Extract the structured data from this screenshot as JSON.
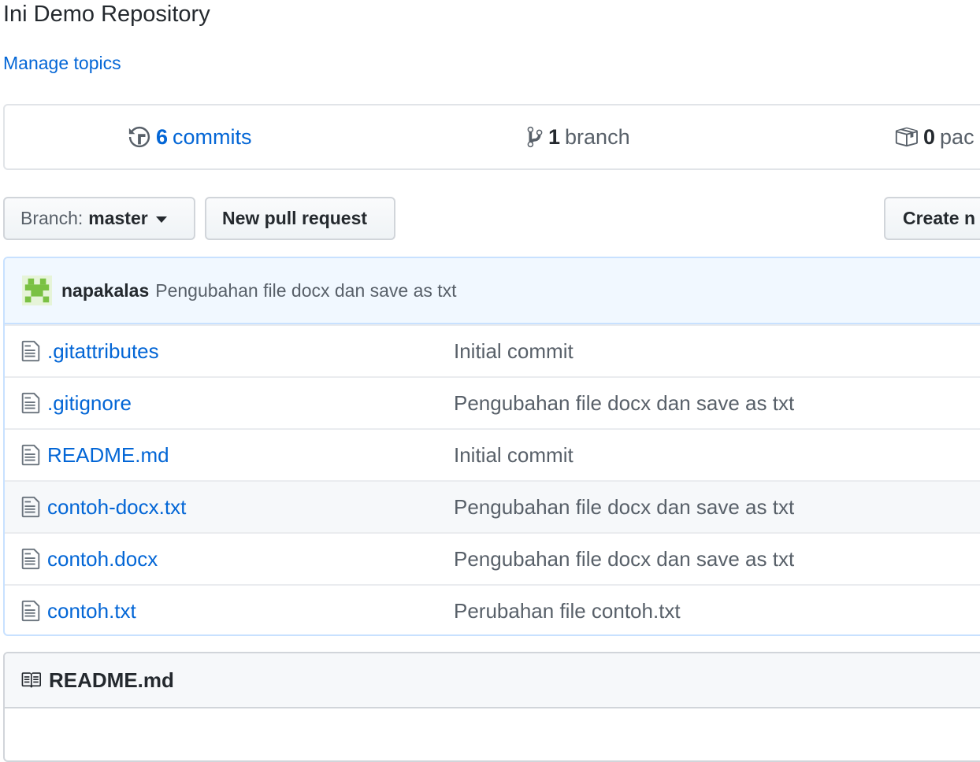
{
  "repo": {
    "description": "Ini Demo Repository",
    "manage_topics": "Manage topics"
  },
  "summary": {
    "commits": {
      "count": "6",
      "label": "commits",
      "icon": "history-icon"
    },
    "branches": {
      "count": "1",
      "label": "branch",
      "icon": "git-branch-icon"
    },
    "packages": {
      "count": "0",
      "label": "pac",
      "icon": "package-icon"
    }
  },
  "toolbar": {
    "branch_prefix": "Branch:",
    "branch_name": "master",
    "new_pull_request": "New pull request",
    "create_new_file": "Create n"
  },
  "commit_tease": {
    "author": "napakalas",
    "message": "Pengubahan file docx dan save as txt"
  },
  "files": [
    {
      "name": ".gitattributes",
      "message": "Initial commit",
      "icon": "file-icon"
    },
    {
      "name": ".gitignore",
      "message": "Pengubahan file docx dan save as txt",
      "icon": "file-icon"
    },
    {
      "name": "README.md",
      "message": "Initial commit",
      "icon": "file-icon"
    },
    {
      "name": "contoh-docx.txt",
      "message": "Pengubahan file docx dan save as txt",
      "icon": "file-icon",
      "highlighted": true
    },
    {
      "name": "contoh.docx",
      "message": "Pengubahan file docx dan save as txt",
      "icon": "file-icon"
    },
    {
      "name": "contoh.txt",
      "message": "Perubahan file contoh.txt",
      "icon": "file-icon"
    }
  ],
  "readme": {
    "title": "README.md",
    "icon": "book-icon"
  },
  "colors": {
    "link": "#0366d6",
    "text": "#24292e",
    "muted": "#586069",
    "commit_tease_bg": "#f1f8ff",
    "border_blue": "#c8e1ff"
  }
}
